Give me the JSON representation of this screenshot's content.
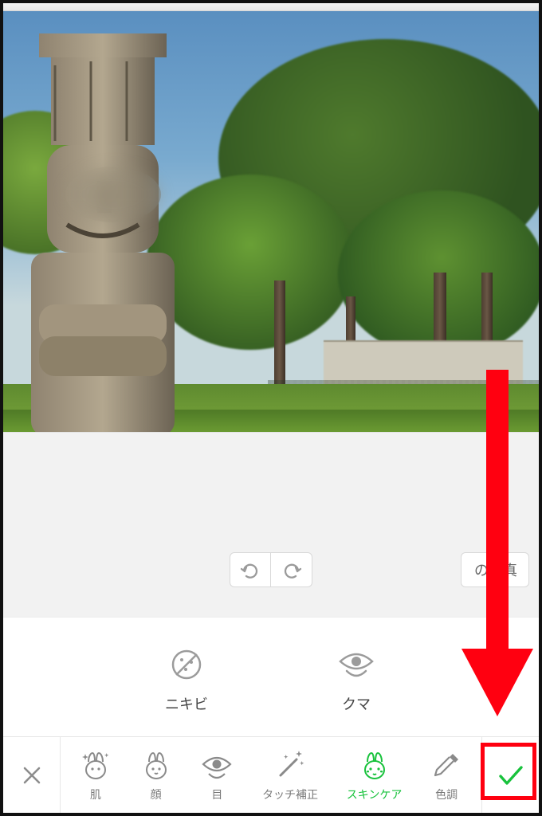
{
  "colors": {
    "accent": "#18c23c",
    "annotation": "#ff0010"
  },
  "midbar": {
    "compare_label": "の写真"
  },
  "tools": {
    "items": [
      {
        "id": "acne",
        "label": "ニキビ"
      },
      {
        "id": "dark-circles",
        "label": "クマ"
      }
    ]
  },
  "bottom": {
    "tabs": [
      {
        "id": "skin",
        "label": "肌",
        "active": false
      },
      {
        "id": "face",
        "label": "顔",
        "active": false
      },
      {
        "id": "eye",
        "label": "目",
        "active": false
      },
      {
        "id": "touchup",
        "label": "タッチ補正",
        "active": false
      },
      {
        "id": "skincare",
        "label": "スキンケア",
        "active": true
      },
      {
        "id": "tone",
        "label": "色調",
        "active": false
      }
    ]
  }
}
